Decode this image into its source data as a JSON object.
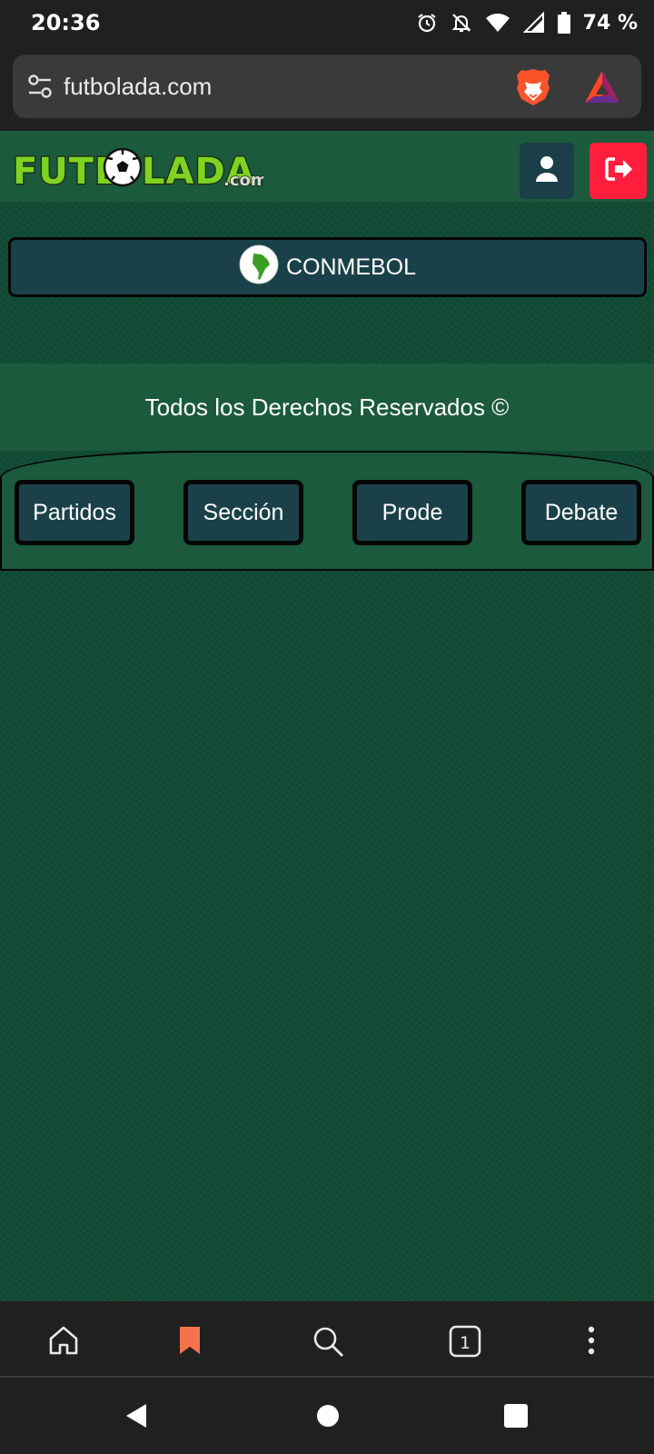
{
  "status_bar": {
    "time": "20:36",
    "battery_text": "74 %",
    "icons": [
      "alarm-icon",
      "notifications-off-icon",
      "wifi-icon",
      "cell-signal-icon",
      "battery-icon"
    ]
  },
  "browser": {
    "url": "futbolada.com",
    "icons": [
      "site-settings-icon",
      "brave-shields-icon",
      "brave-rewards-icon"
    ]
  },
  "site": {
    "logo_text": "FUTBOLADA",
    "logo_suffix": ".com",
    "header_icons": [
      "user-icon",
      "logout-icon"
    ],
    "region_button": "CONMEBOL",
    "copyright": "Todos los Derechos Reservados ©",
    "tabs": [
      {
        "label": "Partidos"
      },
      {
        "label": "Sección"
      },
      {
        "label": "Prode"
      },
      {
        "label": "Debate"
      }
    ],
    "colors": {
      "header_green": "#1b5a3c",
      "background_green": "#0f4a33",
      "button_teal": "#1a4149",
      "logout_red": "#ff1f3d",
      "logo_green": "#7ed321"
    }
  },
  "browser_toolbar": {
    "tab_count": "1",
    "icons": [
      "home-icon",
      "bookmark-icon",
      "search-icon",
      "tabs-icon",
      "more-menu-icon"
    ]
  },
  "nav_bar": {
    "icons": [
      "back-icon",
      "home-circle-icon",
      "recents-icon"
    ]
  }
}
